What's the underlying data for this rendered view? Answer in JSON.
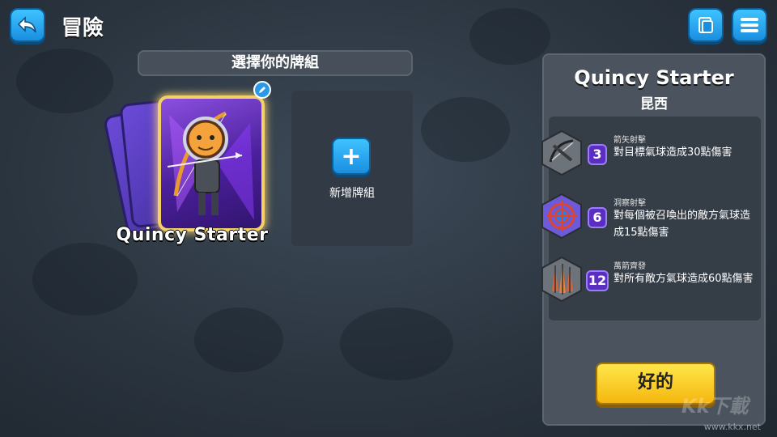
{
  "header": {
    "title": "冒險",
    "back_icon": "back-arrow-icon",
    "deck_icon": "deck-view-icon",
    "menu_icon": "menu-icon"
  },
  "deck_select": {
    "heading": "選擇你的牌組",
    "decks": [
      {
        "name": "Quincy Starter"
      }
    ],
    "new_deck_label": "新增牌組"
  },
  "hero_panel": {
    "name": "Quincy Starter",
    "subname": "昆西",
    "abilities": [
      {
        "name": "箭矢射擊",
        "cost": "3",
        "description": "對目標氣球造成30點傷害",
        "icon": "crossbow-icon"
      },
      {
        "name": "洞察射擊",
        "cost": "6",
        "description": "對每個被召喚出的敵方氣球造成15點傷害",
        "icon": "target-icon"
      },
      {
        "name": "萬箭齊發",
        "cost": "12",
        "description": "對所有敵方氣球造成60點傷害",
        "icon": "arrow-storm-icon"
      }
    ],
    "ok_label": "好的"
  },
  "watermark": {
    "logo": "Kk下載",
    "url": "www.kkx.net"
  },
  "colors": {
    "accent_blue": "#2a9ae8",
    "ok_yellow": "#f5c51a",
    "card_purple": "#6b4bd8",
    "glow_gold": "#f3d068"
  }
}
